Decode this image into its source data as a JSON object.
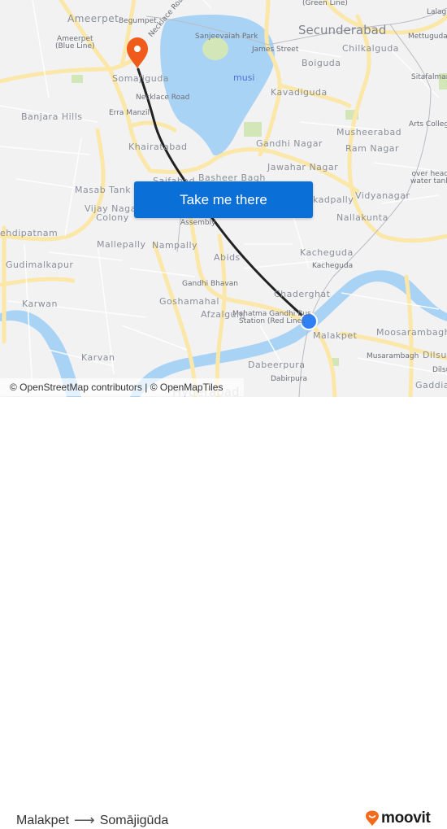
{
  "map": {
    "labels": {
      "ameerpet": "Ameerpet",
      "ameerpet_metro": "Ameerpet\n(Blue Line)",
      "begumpet": "Begumpet",
      "necklace_road_diag": "Necklace Road",
      "sanjeevaiah_park": "Sanjeevaiah Park",
      "secunderabad": "Secunderabad",
      "green_line": "(Green Line)",
      "lalaguda": "Lalagu",
      "mettuguda": "Mettuguda",
      "james_street": "James Street",
      "boiguda": "Boiguda",
      "chilkalguda": "Chilkalguda",
      "somajiguda": "Somajiguda",
      "musi": "musi",
      "kavadiguda": "Kavadiguda",
      "sitafalmandi": "Sitafalman",
      "necklace_road": "Necklace Road",
      "banjara_hills": "Banjara Hills",
      "erra_manzil": "Erra Manzil",
      "arts_college": "Arts College",
      "musheerabad": "Musheerabad",
      "khairatabad": "Khairatabad",
      "gandhi_nagar": "Gandhi Nagar",
      "ram_nagar": "Ram Nagar",
      "saifabad": "Saifabad",
      "basheer_bagh": "Basheer Bagh",
      "jawahar_nagar": "Jawahar Nagar",
      "over_head_tank": "over head\nwater tank",
      "masab_tank": "Masab Tank",
      "vijay_nagar": "Vijay Nagar\nColony",
      "kachiguda_left": "kadpally",
      "vidyanagar": "Vidyanagar",
      "mehdipatnam": "ehdipatnam",
      "assembly": "Assembly",
      "nallakunta": "Nallakunta",
      "mallepally": "Mallepally",
      "nampally": "Nampally",
      "abids": "Abids",
      "kacheguda": "Kacheguda",
      "kacheguda_station": "Kacheguda",
      "gudimalkapur": "Gudimalkapur",
      "gandhi_bhavan": "Gandhi Bhavan",
      "chaderghat": "Chaderghat",
      "karwan": "Karwan",
      "goshamahal": "Goshamahal",
      "mg_bus_station": "Mahatma Gandhi Bus\nStation (Red Line)",
      "afzalgunj": "Afzalgunj",
      "malakpet": "Malakpet",
      "moosarambagh": "Moosarambagh",
      "karvan": "Karvan",
      "musarambagh": "Musarambagh",
      "dilsukh": "Dilsu",
      "dilsukh2": "Dilsu",
      "dabeerpura": "Dabeerpura",
      "dabirpura": "Dabirpura",
      "gaddia": "Gaddia",
      "hyderabad": "Hyderabad"
    },
    "colors": {
      "water": "#a9d3f5",
      "road": "#fbe7a8",
      "park": "#d3e6b8",
      "route": "#222222",
      "origin": "#2f7ff5",
      "destination": "#f05a1a"
    },
    "origin_marker": "Malakpet",
    "destination_marker": "Somājigūda"
  },
  "cta": {
    "label": "Take me there"
  },
  "attribution": "© OpenStreetMap contributors | © OpenMapTiles",
  "footer": {
    "from": "Malakpet",
    "arrow": "⟶",
    "to": "Somājigūda",
    "brand": "moovit",
    "brand_color": "#f26b1d"
  }
}
